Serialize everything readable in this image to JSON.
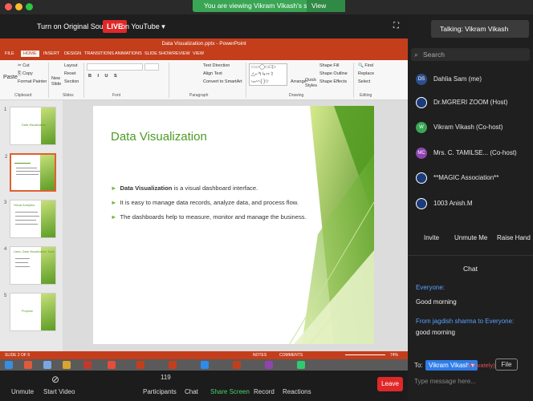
{
  "zoom": {
    "banner_text": "You are viewing Vikram Vikash's screen",
    "view_options": "View Options",
    "original_sound": "Turn on Original Sound",
    "live_badge": "LIVE",
    "youtube_label": "on YouTube",
    "talking": "Talking: Vikram Vikash",
    "search_placeholder": "Search",
    "participants": [
      {
        "initials": "DS",
        "name": "Dahlia Sam (me)",
        "color": "#2d4f8f"
      },
      {
        "initials": "",
        "name": "Dr.MGRERI ZOOM (Host)",
        "color": "#1b3b7a"
      },
      {
        "initials": "W",
        "name": "Vikram Vikash (Co-host)",
        "color": "#3aa655"
      },
      {
        "initials": "MC",
        "name": "Mrs. C. TAMILSE...  (Co-host)",
        "color": "#8e44ad"
      },
      {
        "initials": "",
        "name": "**MAGIC Association**",
        "color": "#1b3b7a"
      },
      {
        "initials": "",
        "name": "1003 Anish.M",
        "color": "#1b3b7a"
      }
    ],
    "panel_buttons": [
      "Invite",
      "Unmute Me",
      "Raise Hand"
    ],
    "chat_title": "Chat",
    "chat": {
      "msg1_from": "Everyone:",
      "msg1_text": "Good morning",
      "msg2_from": "From jagdish sharma to Everyone:",
      "msg2_text": "good morning"
    },
    "to_label": "To:",
    "to_recipient": "Vikram Vikash ▾",
    "privately": "(Privately)",
    "file_label": "File",
    "message_placeholder": "Type message here...",
    "participant_count": "119",
    "bottom_bar": [
      "Unmute",
      "Start Video",
      "Participants",
      "Chat",
      "Share Screen",
      "Record",
      "Reactions"
    ],
    "leave": "Leave"
  },
  "ppt": {
    "window_title": "Data Visualization.pptx - PowerPoint",
    "tabs": [
      "FILE",
      "HOME",
      "INSERT",
      "DESIGN",
      "TRANSITIONS",
      "ANIMATIONS",
      "SLIDE SHOW",
      "REVIEW",
      "VIEW"
    ],
    "ribbon_groups": [
      "Clipboard",
      "Slides",
      "Font",
      "Paragraph",
      "Drawing",
      "Editing"
    ],
    "ribbon_items": {
      "cut": "Cut",
      "copy": "Copy",
      "paste": "Paste",
      "format_painter": "Format Painter",
      "new_slide": "New Slide",
      "layout": "Layout",
      "reset": "Reset",
      "section": "Section",
      "text_direction": "Text Direction",
      "align_text": "Align Text",
      "smartart": "Convert to SmartArt",
      "arrange": "Arrange",
      "quick_styles": "Quick Styles",
      "shape_fill": "Shape Fill",
      "shape_outline": "Shape Outline",
      "shape_effects": "Shape Effects",
      "find": "Find",
      "replace": "Replace",
      "select": "Select"
    },
    "thumb_titles": [
      "Data Visualization",
      "",
      "Visual Analytics",
      "Uses: Data Visualization Tools",
      "Purpose"
    ],
    "slide": {
      "title": "Data Visualization",
      "bullets": [
        {
          "bold": "Data Visualization",
          "text": " is a visual dashboard interface."
        },
        {
          "bold": "",
          "text": "It is easy to manage data records, analyze data, and process flow."
        },
        {
          "bold": "",
          "text": "The dashboards help to measure, monitor and manage the business."
        }
      ]
    },
    "status_left": "SLIDE 2 OF 5",
    "notes": "NOTES",
    "comments": "COMMENTS",
    "zoom_level": "74%"
  }
}
